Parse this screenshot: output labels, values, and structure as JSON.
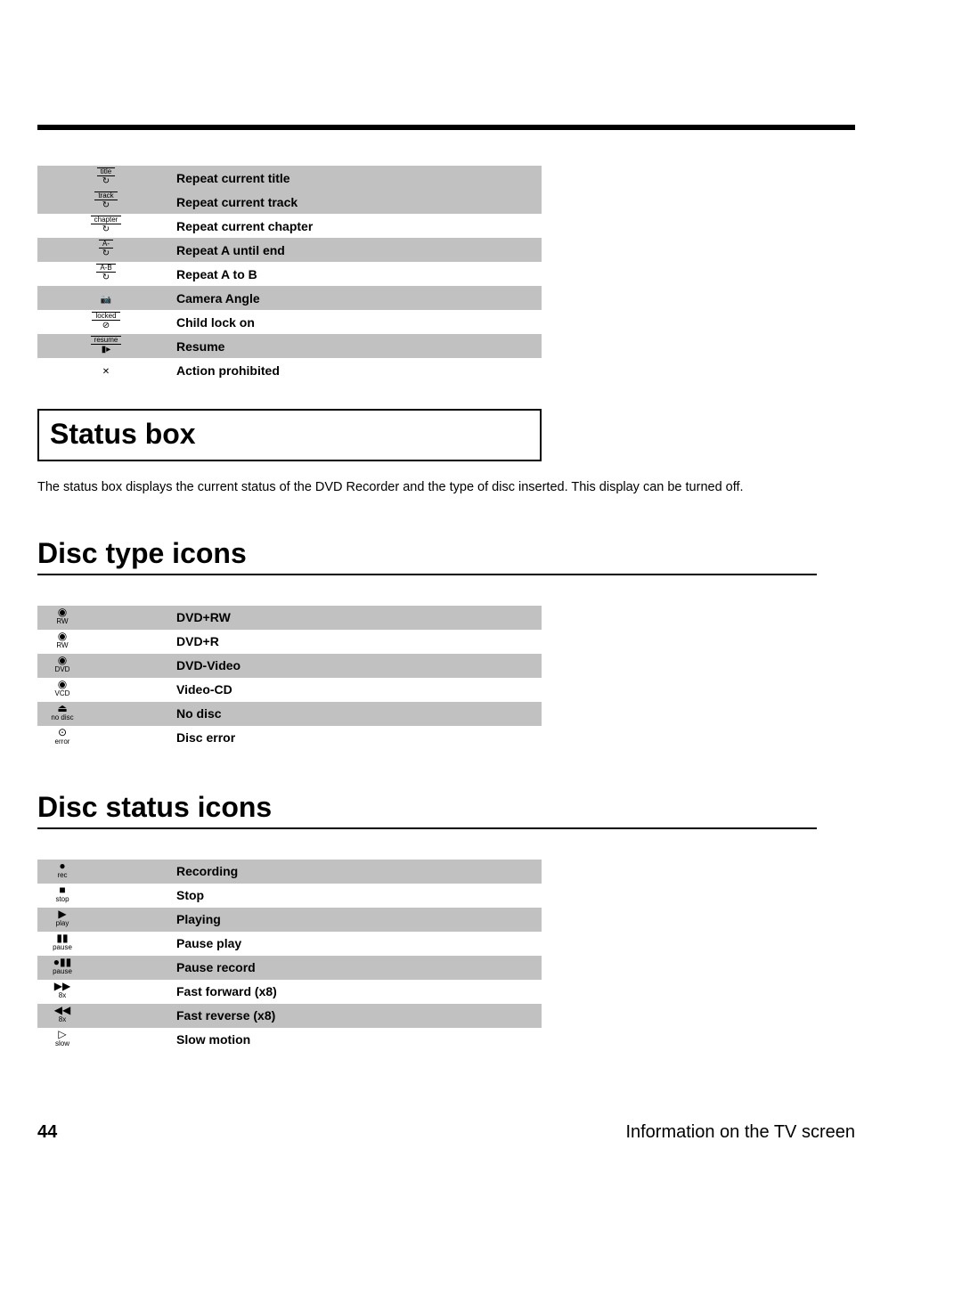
{
  "top_icons": [
    {
      "icon_label": "title",
      "glyph": "↻",
      "desc": "Repeat current title",
      "shaded": true
    },
    {
      "icon_label": "track",
      "glyph": "↻",
      "desc": "Repeat current track",
      "shaded": true
    },
    {
      "icon_label": "chapter",
      "glyph": "↻",
      "desc": "Repeat current chapter",
      "shaded": false
    },
    {
      "icon_label": "A-",
      "glyph": "↻",
      "desc": "Repeat A until end",
      "shaded": true
    },
    {
      "icon_label": "A-B",
      "glyph": "↻",
      "desc": "Repeat A to B",
      "shaded": false
    },
    {
      "icon_label": "",
      "glyph": "📷",
      "desc": "Camera Angle",
      "shaded": true
    },
    {
      "icon_label": "locked",
      "glyph": "⊘",
      "desc": "Child lock on",
      "shaded": false
    },
    {
      "icon_label": "resume",
      "glyph": "▮▸",
      "desc": "Resume",
      "shaded": true
    },
    {
      "icon_label": "",
      "glyph": "✕",
      "desc": "Action prohibited",
      "shaded": false
    }
  ],
  "status_box": {
    "heading": "Status box",
    "paragraph": "The status box displays the current status of the DVD Recorder and the type of disc inserted. This display can be turned off."
  },
  "disc_type": {
    "heading": "Disc type icons",
    "rows": [
      {
        "icon_label": "RW",
        "glyph": "◉",
        "desc": "DVD+RW",
        "shaded": true
      },
      {
        "icon_label": "RW",
        "glyph": "◉",
        "desc": "DVD+R",
        "shaded": false
      },
      {
        "icon_label": "DVD",
        "glyph": "◉",
        "desc": "DVD-Video",
        "shaded": true
      },
      {
        "icon_label": "VCD",
        "glyph": "◉",
        "desc": "Video-CD",
        "shaded": false
      },
      {
        "icon_label": "no disc",
        "glyph": "⏏",
        "desc": "No disc",
        "shaded": true
      },
      {
        "icon_label": "error",
        "glyph": "⊙",
        "desc": "Disc error",
        "shaded": false
      }
    ]
  },
  "disc_status": {
    "heading": "Disc status icons",
    "rows": [
      {
        "icon_label": "rec",
        "glyph": "●",
        "desc": "Recording",
        "shaded": true
      },
      {
        "icon_label": "stop",
        "glyph": "■",
        "desc": "Stop",
        "shaded": false
      },
      {
        "icon_label": "play",
        "glyph": "▶",
        "desc": "Playing",
        "shaded": true
      },
      {
        "icon_label": "pause",
        "glyph": "▮▮",
        "desc": "Pause play",
        "shaded": false
      },
      {
        "icon_label": "pause",
        "glyph": "●▮▮",
        "desc": "Pause record",
        "shaded": true
      },
      {
        "icon_label": "8x",
        "glyph": "▶▶",
        "desc": "Fast forward (x8)",
        "shaded": false
      },
      {
        "icon_label": "8x",
        "glyph": "◀◀",
        "desc": "Fast reverse (x8)",
        "shaded": true
      },
      {
        "icon_label": "slow",
        "glyph": "▷",
        "desc": "Slow motion",
        "shaded": false
      }
    ]
  },
  "footer": {
    "page_number": "44",
    "text": "Information on the TV screen"
  }
}
